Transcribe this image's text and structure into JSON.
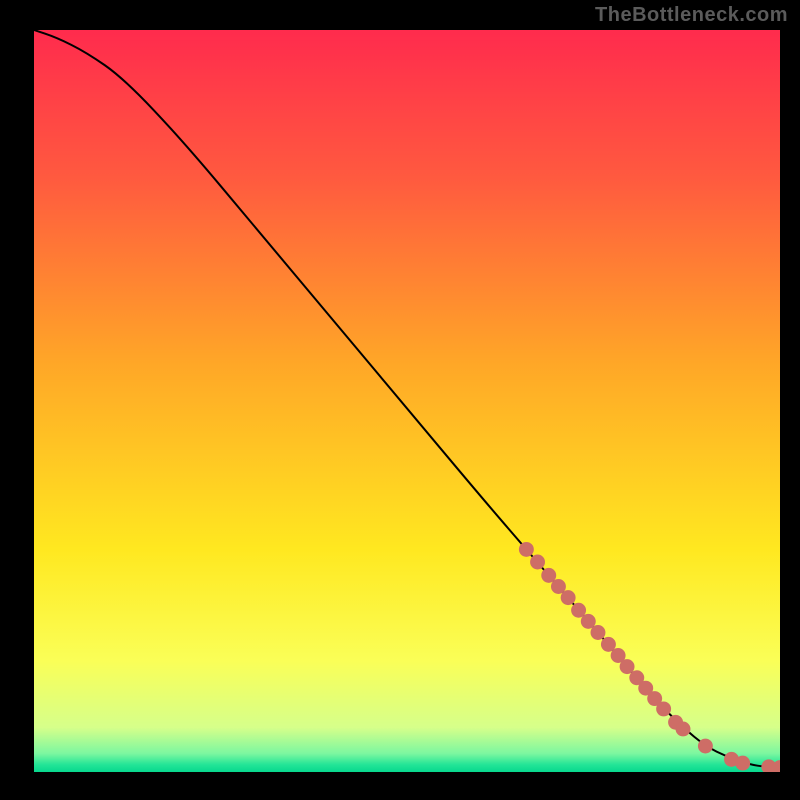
{
  "attribution": "TheBottleneck.com",
  "colors": {
    "frame": "#000000",
    "line": "#000000",
    "marker": "#ce6d66",
    "gradient_stops": [
      {
        "offset": 0.0,
        "color": "#ff2b4d"
      },
      {
        "offset": 0.2,
        "color": "#ff5a3f"
      },
      {
        "offset": 0.45,
        "color": "#ffa727"
      },
      {
        "offset": 0.7,
        "color": "#ffe820"
      },
      {
        "offset": 0.85,
        "color": "#faff57"
      },
      {
        "offset": 0.94,
        "color": "#d6ff8a"
      },
      {
        "offset": 0.975,
        "color": "#7cf7a0"
      },
      {
        "offset": 0.99,
        "color": "#24e597"
      },
      {
        "offset": 1.0,
        "color": "#07d88e"
      }
    ]
  },
  "chart_data": {
    "type": "line",
    "title": "",
    "xlabel": "",
    "ylabel": "",
    "xlim": [
      0,
      100
    ],
    "ylim": [
      0,
      100
    ],
    "grid": false,
    "legend": false,
    "note": "Axes unlabeled; x/y are 0–100 percent of plot width/height from bottom-left. Line estimated from pixels.",
    "series": [
      {
        "name": "curve",
        "x": [
          0,
          3,
          7,
          12,
          20,
          30,
          40,
          50,
          60,
          66,
          72,
          78,
          83,
          87,
          90,
          93,
          96,
          98,
          100
        ],
        "y": [
          100,
          99,
          97,
          93.5,
          85,
          73,
          61,
          49,
          37,
          30,
          23,
          16,
          10,
          6,
          3.5,
          2,
          1,
          0.7,
          0.6
        ]
      }
    ],
    "markers": {
      "note": "Salmon dots along the curve (approximate positions)",
      "r": 1.0,
      "points": [
        {
          "x": 66,
          "y": 30
        },
        {
          "x": 67.5,
          "y": 28.3
        },
        {
          "x": 69,
          "y": 26.5
        },
        {
          "x": 70.3,
          "y": 25
        },
        {
          "x": 71.6,
          "y": 23.5
        },
        {
          "x": 73,
          "y": 21.8
        },
        {
          "x": 74.3,
          "y": 20.3
        },
        {
          "x": 75.6,
          "y": 18.8
        },
        {
          "x": 77,
          "y": 17.2
        },
        {
          "x": 78.3,
          "y": 15.7
        },
        {
          "x": 79.5,
          "y": 14.2
        },
        {
          "x": 80.8,
          "y": 12.7
        },
        {
          "x": 82,
          "y": 11.3
        },
        {
          "x": 83.2,
          "y": 9.9
        },
        {
          "x": 84.4,
          "y": 8.5
        },
        {
          "x": 86,
          "y": 6.7
        },
        {
          "x": 87,
          "y": 5.8
        },
        {
          "x": 90,
          "y": 3.5
        },
        {
          "x": 93.5,
          "y": 1.7
        },
        {
          "x": 95,
          "y": 1.2
        },
        {
          "x": 98.5,
          "y": 0.7
        },
        {
          "x": 100,
          "y": 0.6
        }
      ]
    }
  }
}
